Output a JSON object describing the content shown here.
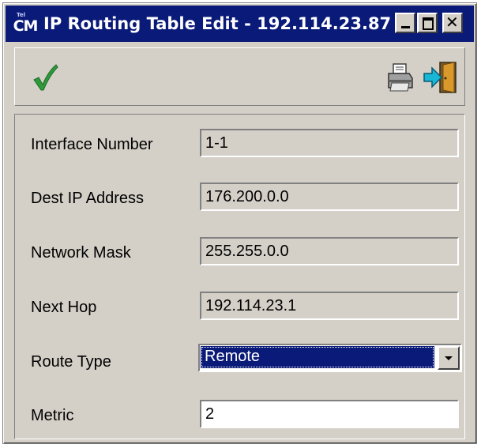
{
  "window": {
    "title": "IP Routing Table Edit - 192.114.23.87",
    "app_icon_text": "CM",
    "app_icon_mini": "Tel"
  },
  "toolbar": {
    "ok_icon": "checkmark-icon",
    "print_icon": "printer-icon",
    "exit_icon": "exit-door-icon"
  },
  "form": {
    "interface_number": {
      "label": "Interface Number",
      "value": "1-1"
    },
    "dest_ip": {
      "label": "Dest IP Address",
      "value": "176.200.0.0"
    },
    "network_mask": {
      "label": "Network Mask",
      "value": "255.255.0.0"
    },
    "next_hop": {
      "label": "Next Hop",
      "value": "192.114.23.1"
    },
    "route_type": {
      "label": "Route Type",
      "value": "Remote"
    },
    "metric": {
      "label": "Metric",
      "value": "2"
    }
  },
  "colors": {
    "title_bar": "#0a1a78",
    "window_face": "#d4d0c8",
    "selection": "#0a1a78",
    "check_green": "#2e9a3a",
    "exit_cyan": "#19b7d6"
  }
}
